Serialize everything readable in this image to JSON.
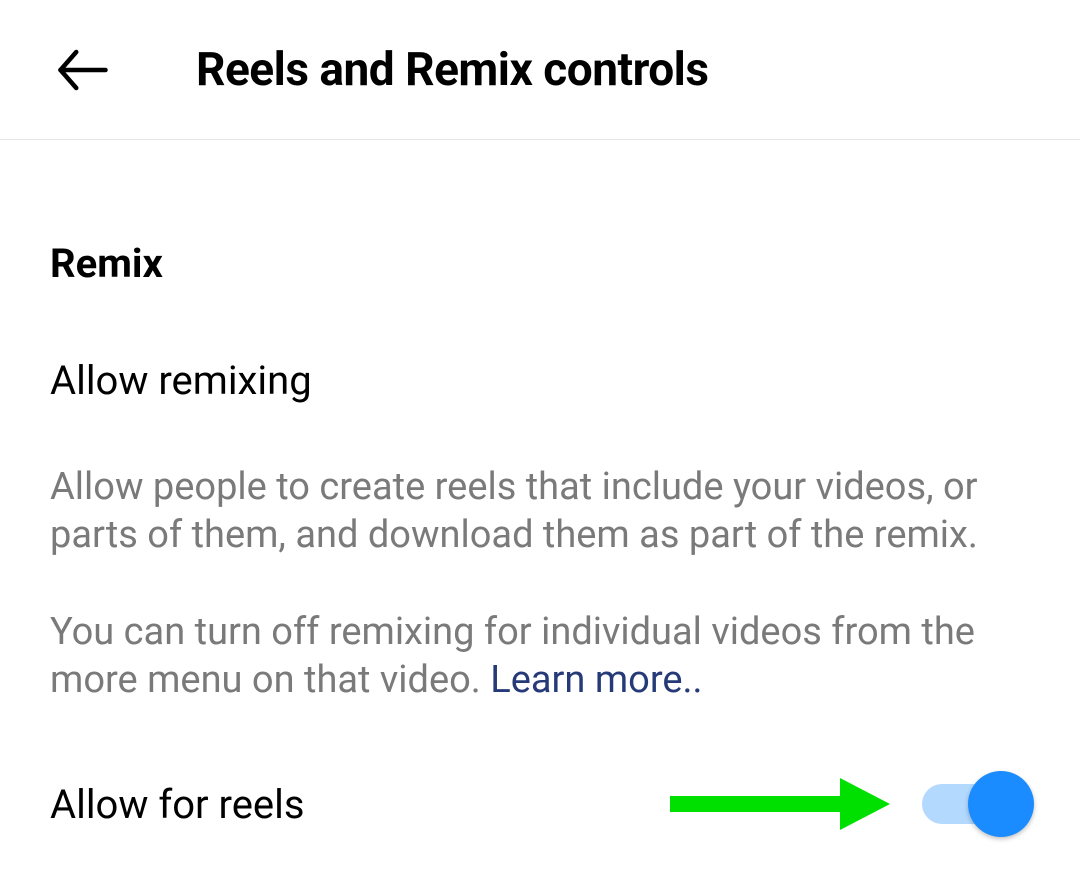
{
  "header": {
    "title": "Reels and Remix controls"
  },
  "section": {
    "title": "Remix",
    "subheading": "Allow remixing",
    "desc1": "Allow people to create reels that include your videos, or parts of them, and download them as part of the remix.",
    "desc2_pre": "You can turn off remixing for individual videos from the more menu on that video. ",
    "learn_more": "Learn more..",
    "toggle_label": "Allow for reels",
    "toggle_on": true
  },
  "colors": {
    "annotation_arrow": "#00e000",
    "switch_track": "#b3d9ff",
    "switch_knob": "#1a8cff",
    "muted_text": "#7a7a7a",
    "link_text": "#263a78"
  }
}
